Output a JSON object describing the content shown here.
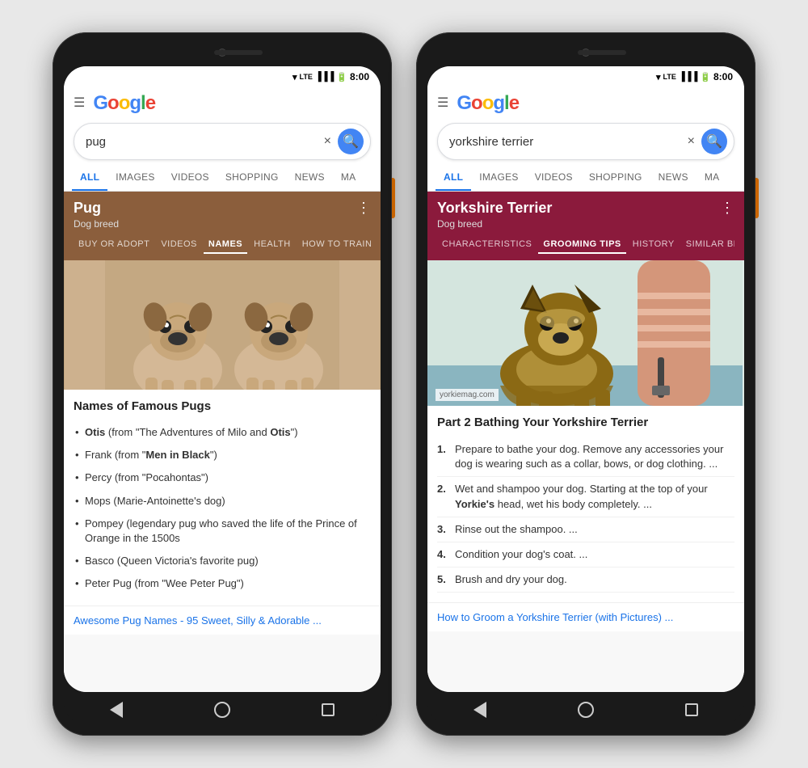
{
  "phone1": {
    "status_bar": {
      "time": "8:00"
    },
    "header": {
      "menu_label": "☰",
      "logo_g": "G",
      "logo_oogle": "oogle"
    },
    "search": {
      "query": "pug",
      "clear_btn": "×",
      "search_btn": "🔍"
    },
    "tabs": [
      {
        "label": "ALL",
        "active": true
      },
      {
        "label": "IMAGES",
        "active": false
      },
      {
        "label": "VIDEOS",
        "active": false
      },
      {
        "label": "SHOPPING",
        "active": false
      },
      {
        "label": "NEWS",
        "active": false
      },
      {
        "label": "MA",
        "active": false
      }
    ],
    "knowledge_panel": {
      "title": "Pug",
      "subtitle": "Dog breed",
      "menu": "⋮",
      "tabs": [
        {
          "label": "BUY OR ADOPT",
          "active": false
        },
        {
          "label": "VIDEOS",
          "active": false
        },
        {
          "label": "NAMES",
          "active": true
        },
        {
          "label": "HEALTH",
          "active": false
        },
        {
          "label": "HOW TO TRAIN",
          "active": false
        }
      ]
    },
    "content": {
      "names_title": "Names of Famous Pugs",
      "names": [
        {
          "text": "Otis",
          "bold": "Otis",
          "rest": " (from \"The Adventures of Milo and ",
          "bold2": "Otis",
          "end": "\")"
        },
        {
          "text": "Frank (from \"Men in Black\")"
        },
        {
          "text": "Percy (from \"Pocahontas\")"
        },
        {
          "text": "Mops (Marie-Antoinette's dog)"
        },
        {
          "text": "Pompey (legendary pug who saved the life of the Prince of Orange in the 1500s"
        },
        {
          "text": "Basco (Queen Victoria's favorite pug)"
        },
        {
          "text": "Peter Pug (from \"Wee Peter Pug\")"
        }
      ],
      "more_link": "Awesome Pug Names - 95 Sweet, Silly & Adorable ..."
    },
    "nav": {
      "back": "◀",
      "home": "⬤",
      "recent": "■"
    }
  },
  "phone2": {
    "status_bar": {
      "time": "8:00"
    },
    "header": {
      "menu_label": "☰"
    },
    "search": {
      "query": "yorkshire terrier",
      "clear_btn": "×"
    },
    "tabs": [
      {
        "label": "ALL",
        "active": true
      },
      {
        "label": "IMAGES",
        "active": false
      },
      {
        "label": "VIDEOS",
        "active": false
      },
      {
        "label": "SHOPPING",
        "active": false
      },
      {
        "label": "NEWS",
        "active": false
      },
      {
        "label": "MA",
        "active": false
      }
    ],
    "knowledge_panel": {
      "title": "Yorkshire Terrier",
      "subtitle": "Dog breed",
      "menu": "⋮",
      "tabs": [
        {
          "label": "CHARACTERISTICS",
          "active": false
        },
        {
          "label": "GROOMING TIPS",
          "active": true
        },
        {
          "label": "HISTORY",
          "active": false
        },
        {
          "label": "SIMILAR BRE...",
          "active": false
        }
      ]
    },
    "content": {
      "image_source": "yorkiemag.com",
      "steps_title": "Part 2 Bathing Your Yorkshire Terrier",
      "steps": [
        "Prepare to bathe your dog. Remove any accessories your dog is wearing such as a collar, bows, or dog clothing. ...",
        "Wet and shampoo your dog. Starting at the top of your Yorkie's head, wet his body completely. ...",
        "Rinse out the shampoo. ...",
        "Condition your dog's coat. ...",
        "Brush and dry your dog."
      ],
      "more_link": "How to Groom a Yorkshire Terrier (with Pictures) ..."
    }
  }
}
